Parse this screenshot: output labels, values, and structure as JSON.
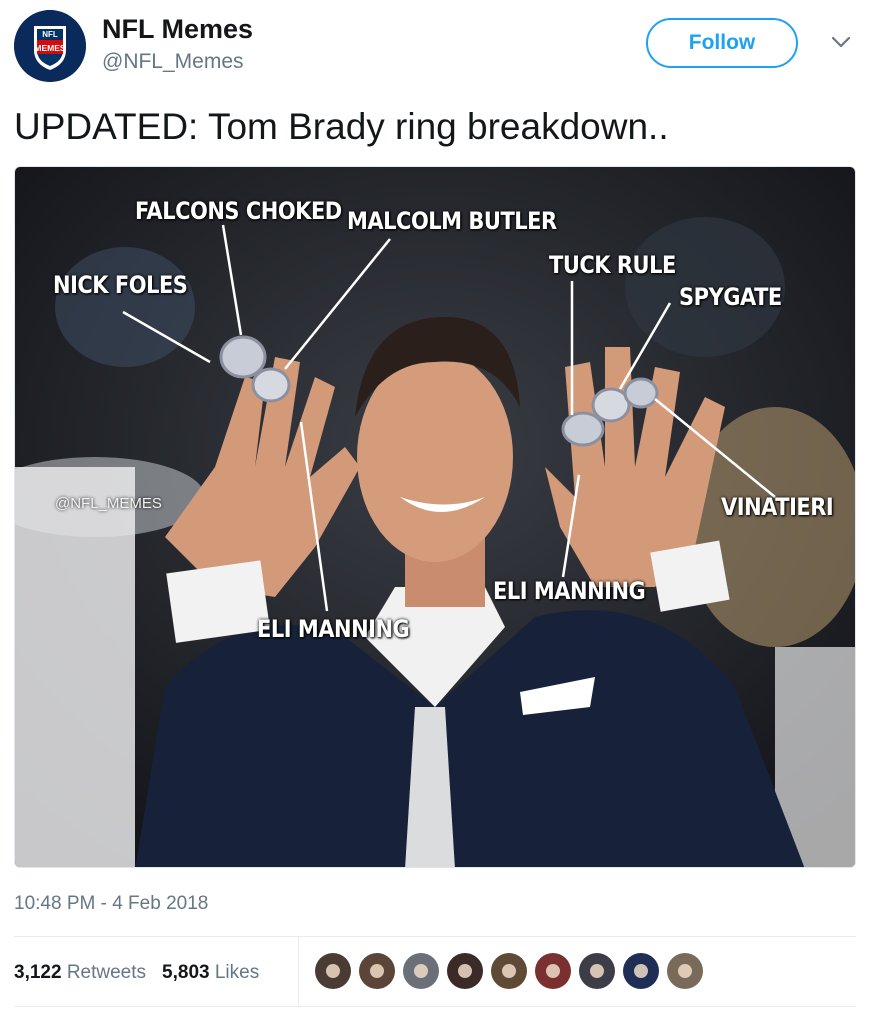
{
  "author": {
    "name": "NFL Memes",
    "handle": "@NFL_Memes",
    "avatar_logo_text_top": "NFL",
    "avatar_logo_text_bottom": "MEMES"
  },
  "follow_button": {
    "label": "Follow"
  },
  "menu": {
    "icon": "chevron-down-icon"
  },
  "tweet": {
    "text": "UPDATED: Tom Brady ring breakdown.."
  },
  "media": {
    "labels": [
      "FALCONS CHOKED",
      "MALCOLM BUTLER",
      "NICK FOLES",
      "TUCK RULE",
      "SPYGATE",
      "VINATIERI",
      "ELI MANNING",
      "ELI MANNING"
    ],
    "watermark": "@NFL_MEMES"
  },
  "timestamp": "10:48 PM - 4 Feb 2018",
  "stats": {
    "retweets_count": "3,122",
    "retweets_label": "Retweets",
    "likes_count": "5,803",
    "likes_label": "Likes"
  },
  "liker_avatars": [
    "#4a3b35",
    "#5a4538",
    "#6b6f78",
    "#3a2a28",
    "#5f4a35",
    "#7a3030",
    "#3d3d48",
    "#1e2e55",
    "#7a6a5a"
  ],
  "colors": {
    "accent": "#1da1f2",
    "text": "#14171a",
    "secondary": "#657786"
  }
}
